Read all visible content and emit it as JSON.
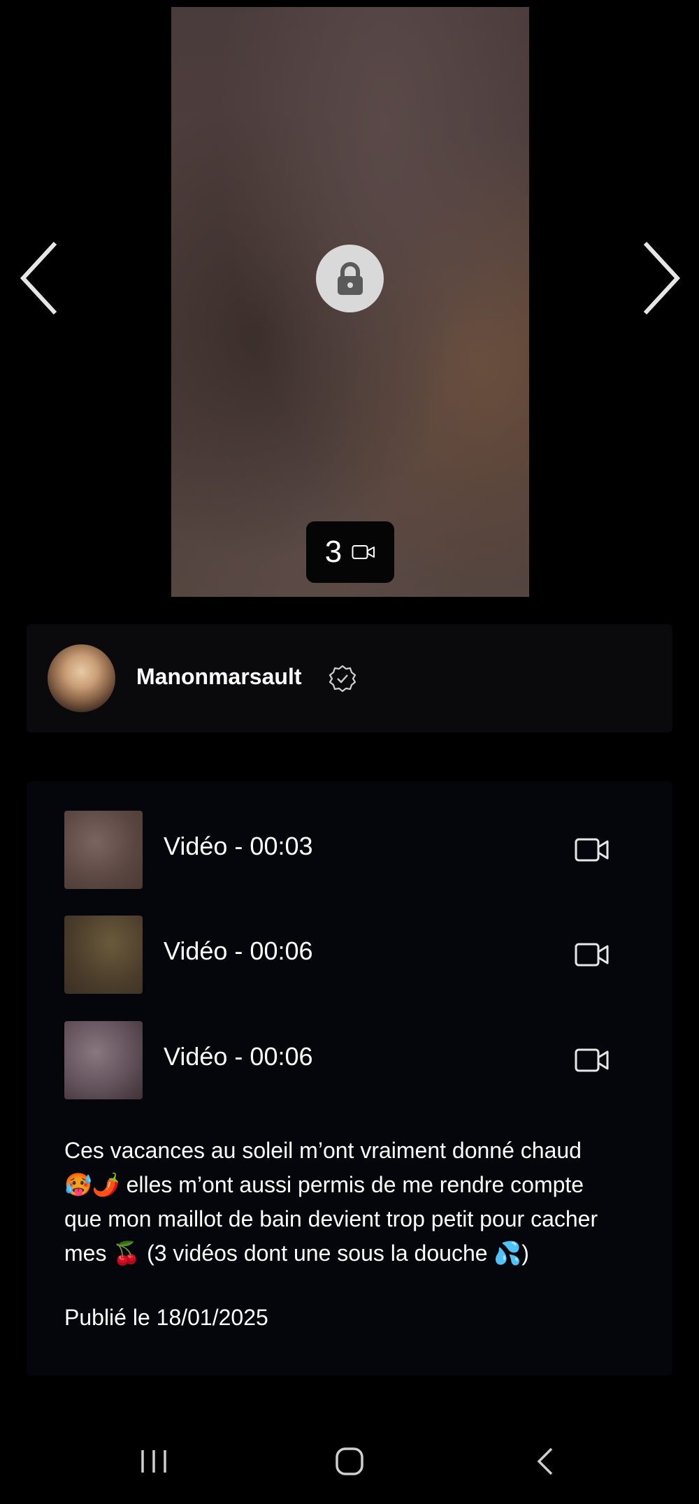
{
  "preview": {
    "media_count": "3"
  },
  "creator": {
    "name": "Manonmarsault"
  },
  "media_items": [
    {
      "label": "Vidéo - 00:03"
    },
    {
      "label": "Vidéo - 00:06"
    },
    {
      "label": "Vidéo - 00:06"
    }
  ],
  "caption": {
    "line1": "Ces vacances au soleil m’ont vraiment donné chaud",
    "line2_emoji": "🥵🌶️",
    "line2_text": " elles m’ont aussi permis de me rendre compte",
    "line3": "que mon maillot de bain devient trop petit pour cacher",
    "line4_start": "mes ",
    "line4_emoji": "🍒",
    "line4_mid": " (3 vidéos dont une sous la douche ",
    "line4_emoji2": "💦",
    "line4_end": ")"
  },
  "published": "Publié le 18/01/2025",
  "icons": {
    "lock": "lock-icon",
    "video": "video-camera-icon",
    "verified": "verified-badge-icon",
    "prev": "chevron-left-icon",
    "next": "chevron-right-icon",
    "nav_recent": "recent-apps-icon",
    "nav_home": "home-icon",
    "nav_back": "back-icon"
  }
}
